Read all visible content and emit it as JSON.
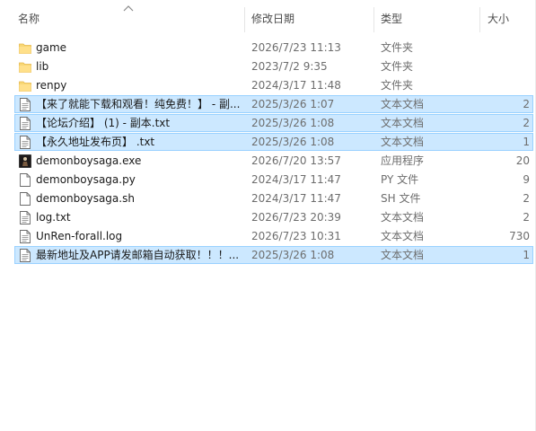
{
  "columns": {
    "name": "名称",
    "date": "修改日期",
    "type": "类型",
    "size": "大小"
  },
  "files": [
    {
      "name": "game",
      "date": "2026/7/23 11:13",
      "type": "文件夹",
      "size": "",
      "icon": "folder-icon",
      "selected": false
    },
    {
      "name": "lib",
      "date": "2023/7/2 9:35",
      "type": "文件夹",
      "size": "",
      "icon": "folder-icon",
      "selected": false
    },
    {
      "name": "renpy",
      "date": "2024/3/17 11:48",
      "type": "文件夹",
      "size": "",
      "icon": "folder-icon",
      "selected": false
    },
    {
      "name": "【来了就能下载和观看！纯免费！】 - 副...",
      "date": "2025/3/26 1:07",
      "type": "文本文档",
      "size": "2",
      "icon": "text-file-icon",
      "selected": true
    },
    {
      "name": "【论坛介绍】 (1) - 副本.txt",
      "date": "2025/3/26 1:08",
      "type": "文本文档",
      "size": "2",
      "icon": "text-file-icon",
      "selected": true
    },
    {
      "name": "【永久地址发布页】 .txt",
      "date": "2025/3/26 1:08",
      "type": "文本文档",
      "size": "1",
      "icon": "text-file-icon",
      "selected": true
    },
    {
      "name": "demonboysaga.exe",
      "date": "2026/7/20 13:57",
      "type": "应用程序",
      "size": "20",
      "icon": "app-icon",
      "selected": false
    },
    {
      "name": "demonboysaga.py",
      "date": "2024/3/17 11:47",
      "type": "PY 文件",
      "size": "9",
      "icon": "blank-file-icon",
      "selected": false
    },
    {
      "name": "demonboysaga.sh",
      "date": "2024/3/17 11:47",
      "type": "SH 文件",
      "size": "2",
      "icon": "blank-file-icon",
      "selected": false
    },
    {
      "name": "log.txt",
      "date": "2026/7/23 20:39",
      "type": "文本文档",
      "size": "2",
      "icon": "text-file-icon",
      "selected": false
    },
    {
      "name": "UnRen-forall.log",
      "date": "2026/7/23 10:31",
      "type": "文本文档",
      "size": "730",
      "icon": "text-file-icon",
      "selected": false
    },
    {
      "name": "最新地址及APP请发邮箱自动获取！！！...",
      "date": "2025/3/26 1:08",
      "type": "文本文档",
      "size": "1",
      "icon": "text-file-icon",
      "selected": true
    }
  ],
  "colors": {
    "selection": "#cce8ff",
    "selection_border": "#99d1ff",
    "folder": "#f8d775"
  }
}
